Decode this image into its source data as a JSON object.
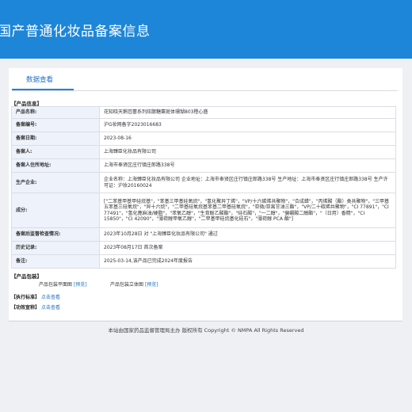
{
  "header": {
    "title": "国产普通化妆品备案信息"
  },
  "tab": {
    "label": "数据查看"
  },
  "product_info": {
    "section_title": "【产品信息】",
    "rows": [
      {
        "key": "产品名称:",
        "value": "花知晓天鹅芭蕾系列炫腮糖粟斑体珊瑚803橙心盛"
      },
      {
        "key": "备案编号:",
        "value": "沪G妆网备字2023016683"
      },
      {
        "key": "备案日期:",
        "value": "2023-08-16"
      },
      {
        "key": "备案人:",
        "value": "上海臻臣化妆品有限公司"
      },
      {
        "key": "备案人住所地址:",
        "value": "上海市奉贤区庄行镇庄郎路338号"
      },
      {
        "key": "生产企业:",
        "value": "企业名称：上海臻臣化妆品有限公司 企业地址：上海市奉贤区庄行镇庄郎路338号 生产地址：上海市奉贤区庄行镇庄郎路338号 生产许可证：沪妆20160024"
      },
      {
        "key": "成分:",
        "value": "[\"二苯基甲基甲硅烷基\"，\"苯基三甲基硅氧烷\"，\"氢化聚异丁烯\"，\"VP/十六碳烯共聚物\"，\"合成蜡\"，\"丙烯酸（酯）类共聚物\"，\"三甲基五苯基三硅氧烷\"，\"异十六烷\"，\"二甲基硅氧烷基苯基二甲基硅氧烷\"，\"亚微/亚离甘油三酯\"，\"VP/二十碳烯共聚物\"，\"CI 77891\"，\"CI 77491\"，\"氢化蓖麻油/硬脂\"，\"苯氧乙醇\"，\"生育酚乙酸酯\"，\"硅石酸\"，\"一二醇\"，\"偏硼酸二醇酯\"，\"（日用）香精\"，\"CI 15850\"，\"CI 42090\"，\"薄荷醇甲氧乙醇\"，\"二甲基甲硅烷基化硅石\"，\"薄荷醇 PCA 酯\"]"
      },
      {
        "key": "备案后监督检查情况:",
        "value": "2023年10月28日 对 \"上海臻臣化妆品有限公司\" 通过"
      },
      {
        "key": "历史记录:",
        "value": "2023年08月17日 首次备案"
      },
      {
        "key": "备注:",
        "value": "2025-03-14,该产品已完成2024年度报告"
      }
    ]
  },
  "packaging": {
    "section_title": "【产品包装】",
    "flat_label": "产品包装平面图",
    "flat_link": "[预览]",
    "stereo_label": "产品包装立体图",
    "stereo_link": "[预览]"
  },
  "standard": {
    "section_title": "【执行标准】",
    "link": "点击查看"
  },
  "efficacy": {
    "section_title": "【功效宣称】",
    "link": "点击查看"
  },
  "footer": {
    "text": "本站由国家药品监督管理局主办 版权所有 Copyright © NMPA All Rights Reserved"
  },
  "colors": {
    "header": "#1e86d8",
    "link": "#1e6fc2",
    "key_bg": "#eef3fb"
  }
}
